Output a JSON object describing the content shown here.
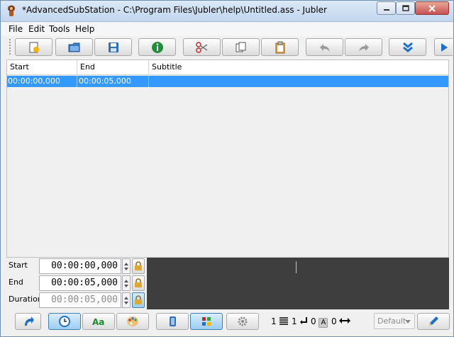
{
  "window": {
    "title": "*AdvancedSubStation - C:\\Program Files\\Jubler\\help\\Untitled.ass - Jubler"
  },
  "menu": [
    "File",
    "Edit",
    "Tools",
    "Help"
  ],
  "table": {
    "columns": [
      "Start",
      "End",
      "Subtitle"
    ],
    "rows": [
      {
        "start": "00:00:00,000",
        "end": "00:00:05,000",
        "subtitle": ""
      }
    ]
  },
  "editor": {
    "start": {
      "label": "Start",
      "value": "00:00:00,000"
    },
    "end": {
      "label": "End",
      "value": "00:00:05,000"
    },
    "duration": {
      "label": "Duration",
      "value": "00:00:05,000"
    }
  },
  "status": {
    "lines": "1",
    "newlines": "1",
    "chars": "0",
    "chars_icon": "A",
    "width": "0"
  },
  "style_select": {
    "value": "Default"
  },
  "colors": {
    "selection": "#3399ff",
    "waveform": "#3e3e3e",
    "cursor": "#ffcc00"
  }
}
